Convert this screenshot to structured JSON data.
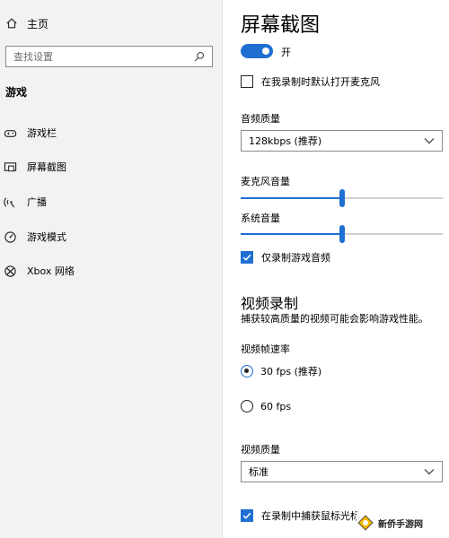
{
  "sidebar": {
    "home_label": "主页",
    "search_placeholder": "查找设置",
    "section_title": "游戏",
    "items": [
      {
        "label": "游戏栏",
        "icon": "game-bar-icon"
      },
      {
        "label": "屏幕截图",
        "icon": "captures-icon"
      },
      {
        "label": "广播",
        "icon": "broadcast-icon"
      },
      {
        "label": "游戏模式",
        "icon": "game-mode-icon"
      },
      {
        "label": "Xbox 网络",
        "icon": "xbox-icon"
      }
    ]
  },
  "main": {
    "title": "屏幕截图",
    "toggle": {
      "on": true,
      "state_label": "开"
    },
    "record_mic_default": {
      "label": "在我录制时默认打开麦克风",
      "checked": false
    },
    "audio_quality": {
      "label": "音频质量",
      "value": "128kbps (推荐)"
    },
    "mic_volume": {
      "label": "麦克风音量",
      "level": 0.5
    },
    "system_volume": {
      "label": "系统音量",
      "level": 0.5
    },
    "game_audio_only": {
      "label": "仅录制游戏音频",
      "checked": true
    },
    "video_heading": "视频录制",
    "video_description": "捕获较高质量的视频可能会影响游戏性能。",
    "frame_rate": {
      "label": "视频帧速率",
      "options": [
        {
          "label": "30 fps (推荐)",
          "selected": true
        },
        {
          "label": "60 fps",
          "selected": false
        }
      ]
    },
    "video_quality": {
      "label": "视频质量",
      "value": "标准"
    },
    "capture_cursor": {
      "label": "在录制中捕获鼠标光标",
      "checked": true
    }
  },
  "watermark": {
    "text": "新侨手游网"
  },
  "colors": {
    "accent": "#1f6fd1",
    "sidebar_bg": "#f2f2f2"
  }
}
